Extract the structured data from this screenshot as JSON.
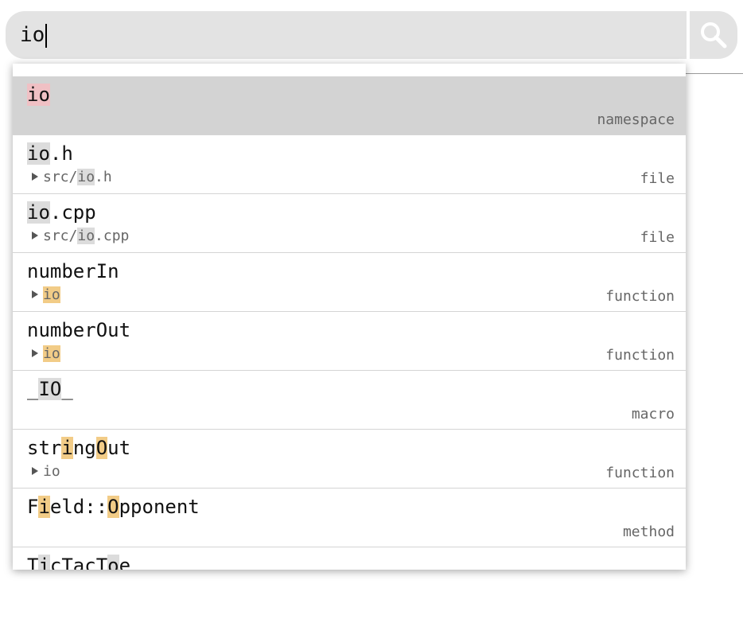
{
  "search": {
    "query": "io",
    "placeholder": "",
    "button_icon": "search-icon"
  },
  "colors": {
    "search_bg": "#e3e3e3",
    "selected_row_bg": "#d3d3d3",
    "match_exact": "#f0c0c4",
    "match_prefix": "#dcdcdc",
    "match_fuzzy": "#f2cc87"
  },
  "results": [
    {
      "name_segments": [
        {
          "text": "io",
          "hl": "red"
        }
      ],
      "path_segments": [],
      "kind": "namespace",
      "selected": true
    },
    {
      "name_segments": [
        {
          "text": "io",
          "hl": "gray"
        },
        {
          "text": ".h",
          "hl": ""
        }
      ],
      "path_segments": [
        {
          "text": "src/",
          "hl": ""
        },
        {
          "text": "io",
          "hl": "gray"
        },
        {
          "text": ".h",
          "hl": ""
        }
      ],
      "kind": "file"
    },
    {
      "name_segments": [
        {
          "text": "io",
          "hl": "gray"
        },
        {
          "text": ".cpp",
          "hl": ""
        }
      ],
      "path_segments": [
        {
          "text": "src/",
          "hl": ""
        },
        {
          "text": "io",
          "hl": "gray"
        },
        {
          "text": ".cpp",
          "hl": ""
        }
      ],
      "kind": "file"
    },
    {
      "name_segments": [
        {
          "text": "numberIn",
          "hl": ""
        }
      ],
      "path_segments": [
        {
          "text": "io",
          "hl": "orange"
        }
      ],
      "kind": "function"
    },
    {
      "name_segments": [
        {
          "text": "numberOut",
          "hl": ""
        }
      ],
      "path_segments": [
        {
          "text": "io",
          "hl": "orange"
        }
      ],
      "kind": "function"
    },
    {
      "name_segments": [
        {
          "text": "_",
          "hl": ""
        },
        {
          "text": "IO",
          "hl": "gray"
        },
        {
          "text": "_",
          "hl": ""
        }
      ],
      "path_segments": [],
      "kind": "macro"
    },
    {
      "name_segments": [
        {
          "text": "str",
          "hl": ""
        },
        {
          "text": "i",
          "hl": "orange"
        },
        {
          "text": "ng",
          "hl": ""
        },
        {
          "text": "O",
          "hl": "orange"
        },
        {
          "text": "ut",
          "hl": ""
        }
      ],
      "path_segments": [
        {
          "text": "io",
          "hl": ""
        }
      ],
      "kind": "function"
    },
    {
      "name_segments": [
        {
          "text": "F",
          "hl": ""
        },
        {
          "text": "i",
          "hl": "orange"
        },
        {
          "text": "eld::",
          "hl": ""
        },
        {
          "text": "O",
          "hl": "orange"
        },
        {
          "text": "pponent",
          "hl": ""
        }
      ],
      "path_segments": [],
      "kind": "method"
    },
    {
      "name_segments": [
        {
          "text": "T",
          "hl": ""
        },
        {
          "text": "i",
          "hl": "gray"
        },
        {
          "text": "cTacT",
          "hl": ""
        },
        {
          "text": "o",
          "hl": "gray"
        },
        {
          "text": "e",
          "hl": ""
        }
      ],
      "path_segments": [],
      "kind": ""
    }
  ]
}
